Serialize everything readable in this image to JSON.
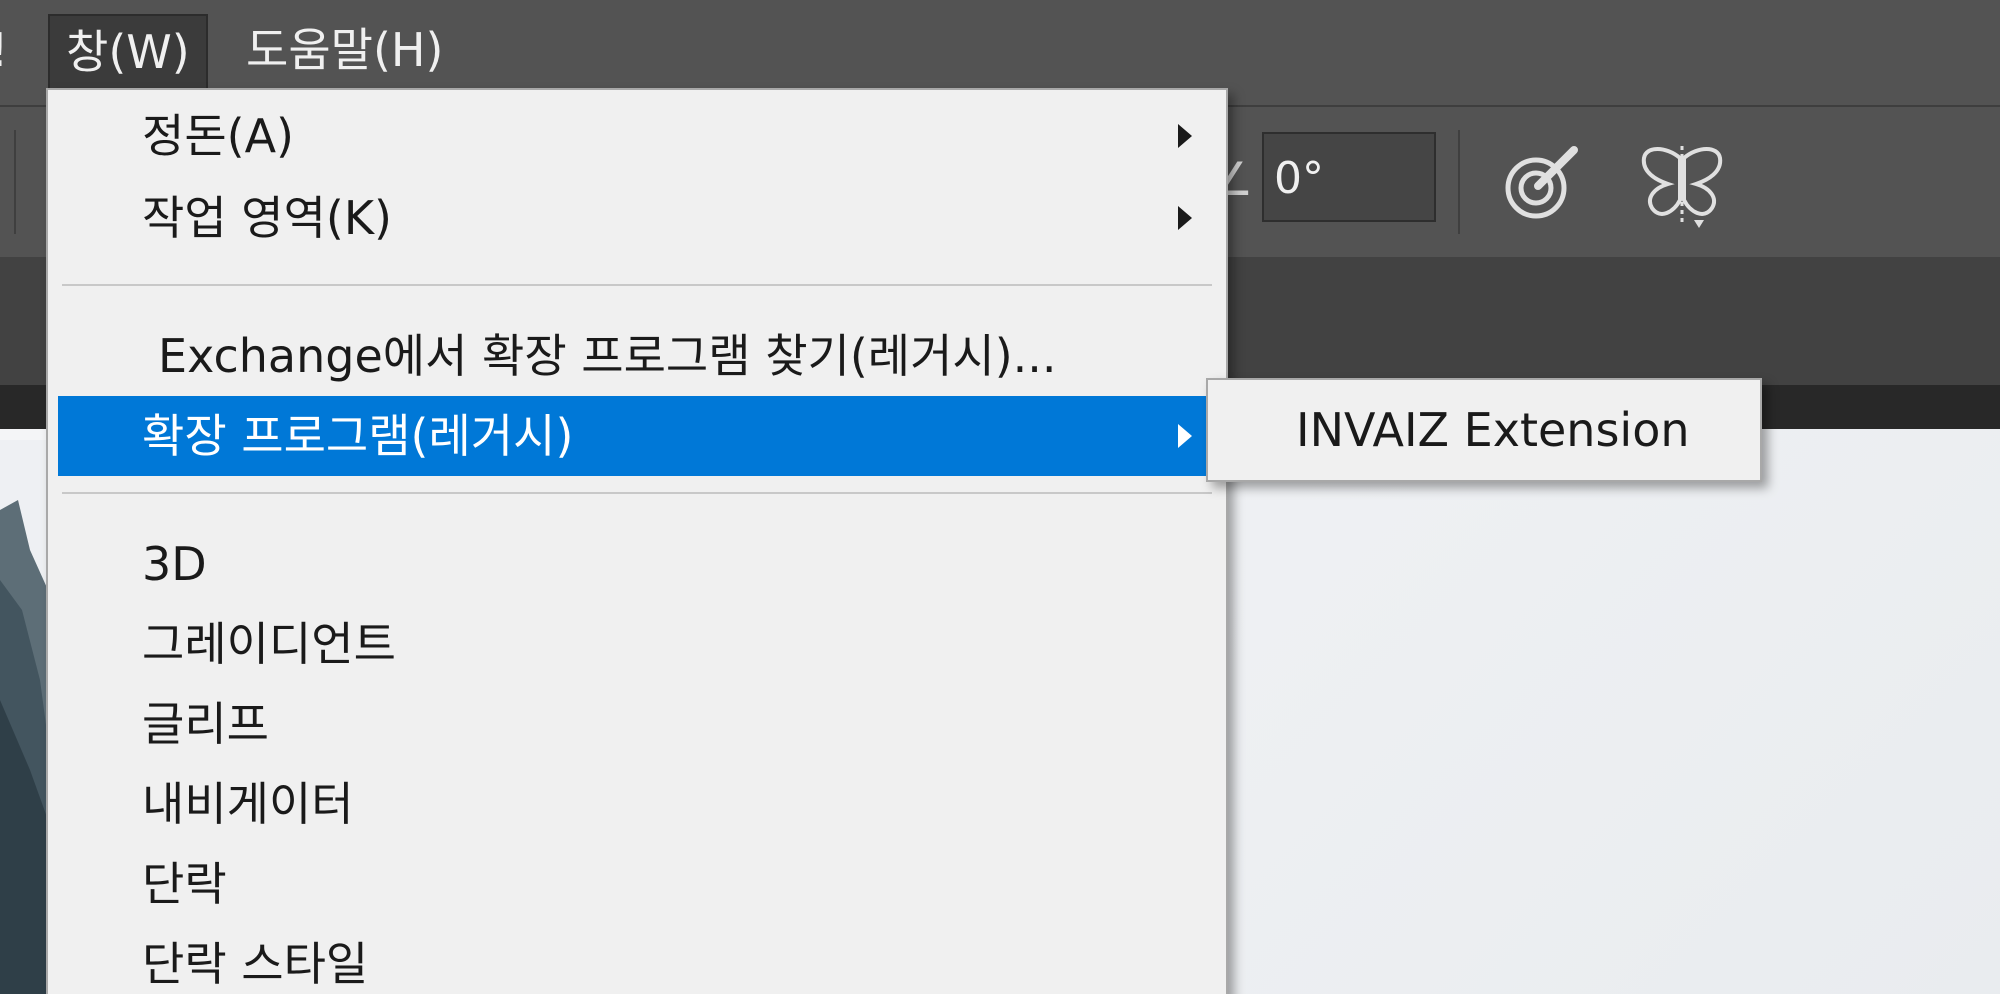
{
  "menubar": {
    "prev_item_fragment": "!",
    "active_menu": "창(W)",
    "help_menu": "도움말(H)"
  },
  "options": {
    "angle_value": "0°"
  },
  "window_menu": {
    "items": [
      {
        "label": "정돈(A)",
        "has_submenu": true
      },
      {
        "label": "작업 영역(K)",
        "has_submenu": true
      },
      {
        "label": "Exchange에서 확장 프로그램 찾기(레거시)...",
        "has_submenu": false
      },
      {
        "label": "확장 프로그램(레거시)",
        "has_submenu": true,
        "highlighted": true
      },
      {
        "label": "3D",
        "has_submenu": false
      },
      {
        "label": "그레이디언트",
        "has_submenu": false
      },
      {
        "label": "글리프",
        "has_submenu": false
      },
      {
        "label": "내비게이터",
        "has_submenu": false
      },
      {
        "label": "단락",
        "has_submenu": false
      },
      {
        "label": "단락 스타일",
        "has_submenu": false
      }
    ]
  },
  "extensions_submenu": {
    "items": [
      {
        "label": "INVAIZ Extension"
      }
    ]
  },
  "icons": {
    "airbrush": "target-brush-icon",
    "symmetry": "butterfly-symmetry-icon"
  },
  "colors": {
    "highlight": "#0078d7",
    "menu_bg": "#f0f0f0",
    "menubar_bg": "#535353"
  }
}
